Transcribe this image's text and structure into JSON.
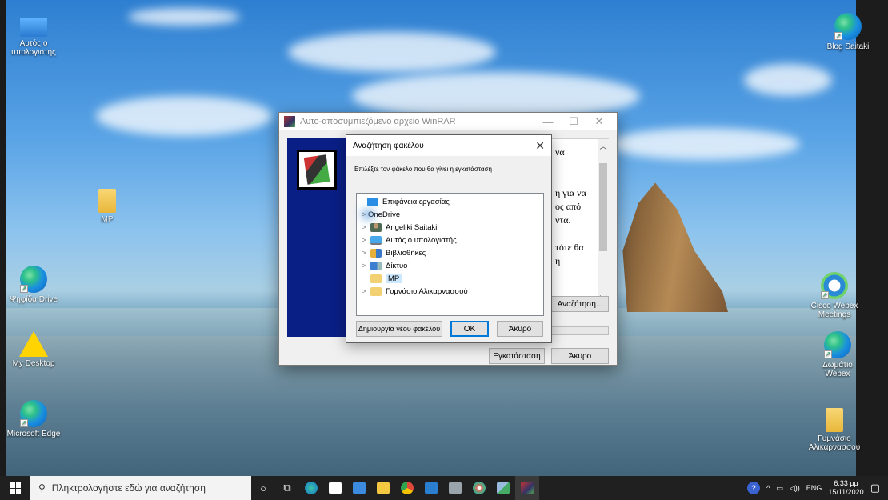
{
  "desktop": {
    "icons_left": [
      {
        "label": "Αυτός ο υπολογιστής",
        "icon": "computer-icon"
      },
      {
        "label": "MP",
        "icon": "folder-icon"
      },
      {
        "label": "Ψηφίδα Drive",
        "icon": "edge-icon"
      },
      {
        "label": "My Desktop",
        "icon": "warning-icon"
      },
      {
        "label": "Microsoft Edge",
        "icon": "edge-icon"
      }
    ],
    "icons_right": [
      {
        "label": "Blog Saitaki",
        "icon": "edge-icon"
      },
      {
        "label": "Cisco Webex Meetings",
        "icon": "webex-icon"
      },
      {
        "label": "Δωμάτιο Webex",
        "icon": "edge-icon"
      },
      {
        "label": "Γυμνάσιο Αλικαρνασσού",
        "icon": "folder-icon"
      }
    ]
  },
  "winrar": {
    "title": "Αυτο-αποσυμπιεζόμενο αρχείο WinRAR",
    "info_lines": [
      "να",
      "",
      "",
      "η για να",
      "ος από",
      "ντα.",
      "",
      "τότε θα",
      "η"
    ],
    "browse_button": "Αναζήτηση...",
    "install_button": "Εγκατάσταση",
    "cancel_button": "Άκυρο"
  },
  "browse_dialog": {
    "title": "Αναζήτηση φακέλου",
    "hint": "Επιλέξτε τον φάκελο που θα γίνει η εγκατάσταση",
    "tree": [
      {
        "label": "Επιφάνεια εργασίας",
        "icon": "desktop-icon",
        "chevron": ""
      },
      {
        "label": "OneDrive",
        "icon": "cloud-icon",
        "chevron": ">"
      },
      {
        "label": "Angeliki Saitaki",
        "icon": "user-icon",
        "chevron": ">"
      },
      {
        "label": "Αυτός ο υπολογιστής",
        "icon": "monitor-icon",
        "chevron": ">"
      },
      {
        "label": "Βιβλιοθήκες",
        "icon": "library-icon",
        "chevron": ">"
      },
      {
        "label": "Δίκτυο",
        "icon": "network-icon",
        "chevron": ">"
      },
      {
        "label": "MP",
        "icon": "folder-icon",
        "chevron": ""
      },
      {
        "label": "Γυμνάσιο Αλικαρνασσού",
        "icon": "folder-icon",
        "chevron": ">"
      }
    ],
    "new_folder_button": "Δημιουργία νέου φακέλου",
    "ok_button": "OK",
    "cancel_button": "Άκυρο"
  },
  "taskbar": {
    "search_placeholder": "Πληκτρολογήστε εδώ για αναζήτηση",
    "language": "ENG",
    "time": "6:33 μμ",
    "date": "15/11/2020"
  }
}
